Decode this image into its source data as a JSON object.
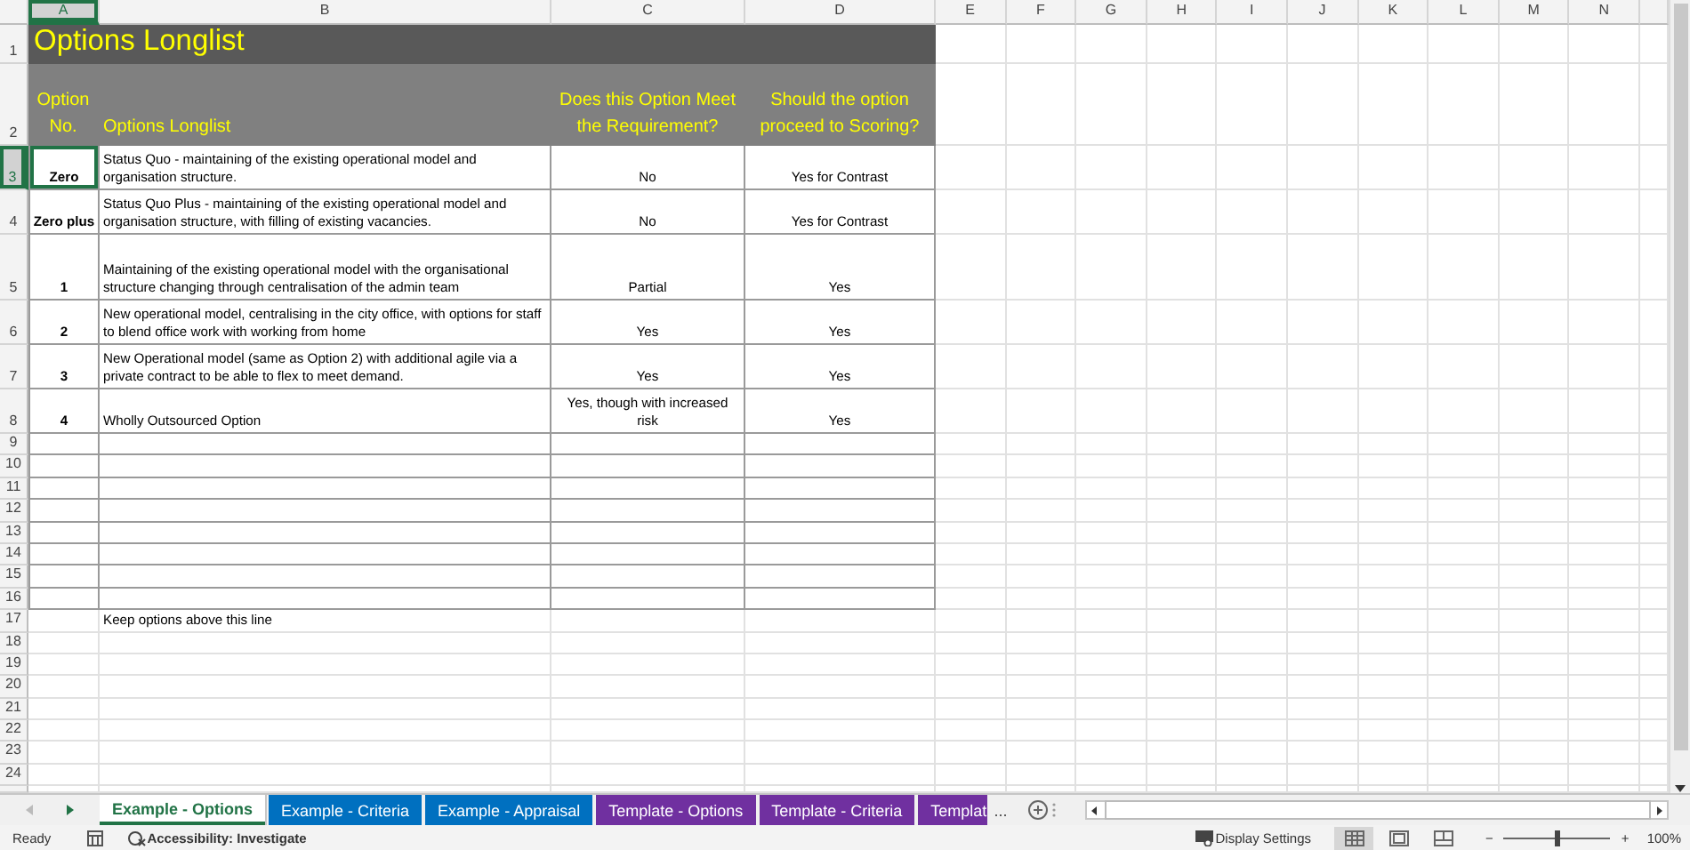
{
  "sheet": {
    "columns": [
      "A",
      "B",
      "C",
      "D",
      "E",
      "F",
      "G",
      "H",
      "I",
      "J",
      "K",
      "L",
      "M",
      "N"
    ],
    "rows": [
      {
        "number": "1",
        "kind": "title",
        "text": "Options Longlist"
      },
      {
        "number": "2",
        "kind": "header",
        "cells": [
          "Option No.",
          "Options Longlist",
          "Does this Option Meet the Requirement?",
          "Should the option proceed to Scoring?"
        ]
      },
      {
        "number": "3",
        "kind": "option",
        "selected": true,
        "cells": [
          "Zero",
          "Status Quo - maintaining of the existing operational model and organisation structure.",
          "No",
          "Yes for Contrast"
        ]
      },
      {
        "number": "4",
        "kind": "option",
        "selected": false,
        "cells": [
          "Zero plus",
          "Status Quo Plus - maintaining of the existing operational model and organisation structure, with filling of existing vacancies.",
          "No",
          "Yes for Contrast"
        ]
      },
      {
        "number": "5",
        "kind": "option",
        "selected": false,
        "cells": [
          "1",
          "Maintaining of the existing operational model with the organisational structure changing through centralisation of the admin team",
          "Partial",
          "Yes"
        ]
      },
      {
        "number": "6",
        "kind": "option",
        "selected": false,
        "cells": [
          "2",
          "New operational model, centralising in the city office, with options for staff to blend office work with working from home",
          "Yes",
          "Yes"
        ]
      },
      {
        "number": "7",
        "kind": "option",
        "selected": false,
        "cells": [
          "3",
          "New Operational model (same as Option 2) with additional agile via a private contract to be able to flex to meet demand.",
          "Yes",
          "Yes"
        ]
      },
      {
        "number": "8",
        "kind": "option",
        "selected": false,
        "cells": [
          "4",
          "Wholly Outsourced Option",
          "Yes, though with increased risk",
          "Yes"
        ]
      },
      {
        "number": "9",
        "kind": "empty_option"
      },
      {
        "number": "10",
        "kind": "empty_option"
      },
      {
        "number": "11",
        "kind": "empty_option"
      },
      {
        "number": "12",
        "kind": "empty_option"
      },
      {
        "number": "13",
        "kind": "empty_option"
      },
      {
        "number": "14",
        "kind": "empty_option"
      },
      {
        "number": "15",
        "kind": "empty_option"
      },
      {
        "number": "16",
        "kind": "empty_option"
      },
      {
        "number": "17",
        "kind": "note",
        "text": "Keep options above this line"
      },
      {
        "number": "18",
        "kind": "blank"
      },
      {
        "number": "19",
        "kind": "blank"
      },
      {
        "number": "20",
        "kind": "blank"
      },
      {
        "number": "21",
        "kind": "blank"
      },
      {
        "number": "22",
        "kind": "blank"
      },
      {
        "number": "23",
        "kind": "blank"
      },
      {
        "number": "24",
        "kind": "blank"
      }
    ]
  },
  "sheet_tabs": [
    {
      "label": "Example - Options",
      "selected": true,
      "color": "#217346"
    },
    {
      "label": "Example - Criteria",
      "selected": false,
      "color": "#0070c0"
    },
    {
      "label": "Example - Appraisal",
      "selected": false,
      "color": "#0070c0"
    },
    {
      "label": "Template - Options",
      "selected": false,
      "color": "#7030a0"
    },
    {
      "label": "Template - Criteria",
      "selected": false,
      "color": "#7030a0"
    },
    {
      "label": "Templat",
      "selected": false,
      "color": "#7030a0"
    }
  ],
  "more_tabs": "...",
  "status_bar": {
    "status": "Ready",
    "accessibility": "Accessibility: Investigate",
    "display_settings": "Display Settings",
    "views": [
      {
        "kind": "normal",
        "selected": true
      },
      {
        "kind": "page_layout",
        "selected": false
      },
      {
        "kind": "page_break",
        "selected": false
      }
    ],
    "zoom_out": "−",
    "zoom_in": "+",
    "zoom": {
      "level": 0.5
    },
    "zoom_text": "100%"
  }
}
